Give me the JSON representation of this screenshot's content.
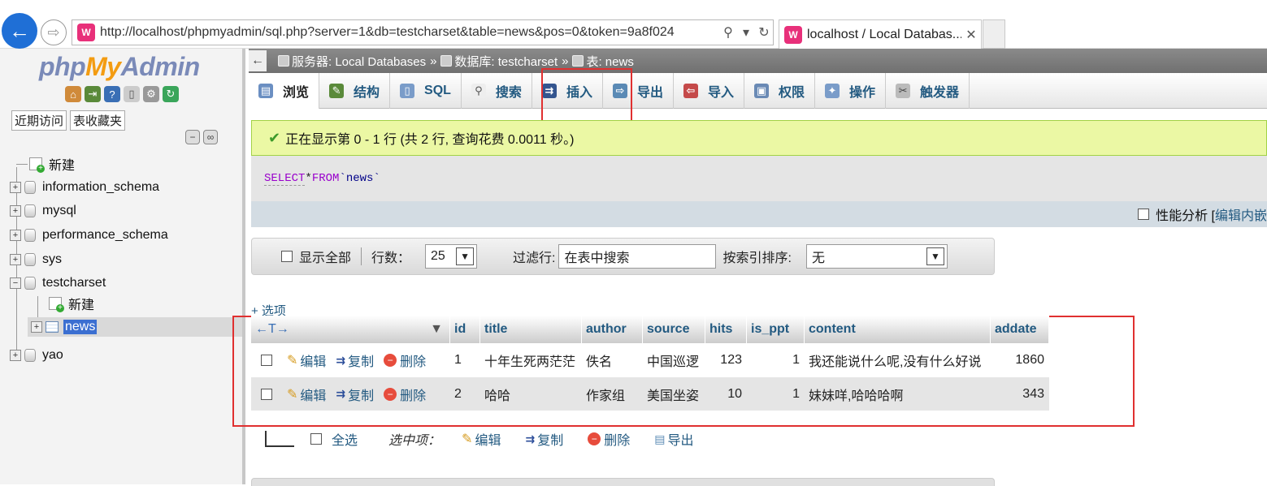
{
  "browser": {
    "url": "http://localhost/phpmyadmin/sql.php?server=1&db=testcharset&table=news&pos=0&token=9a8f024",
    "tab_title": "localhost / Local Databas...",
    "favicon": "W"
  },
  "left": {
    "logo": {
      "php": "php",
      "my": "My",
      "admin": "Admin"
    },
    "tabs": [
      "近期访问",
      "表收藏夹"
    ],
    "tree": {
      "new": "新建",
      "dbs": [
        "information_schema",
        "mysql",
        "performance_schema",
        "sys",
        "testcharset"
      ],
      "testcharset_new": "新建",
      "table": "news",
      "yao": "yao"
    }
  },
  "breadcrumb": {
    "server_label": "服务器: Local Databases",
    "db_label": "数据库: testcharset",
    "table_label": "表: news",
    "sep": "»"
  },
  "tabs": [
    "浏览",
    "结构",
    "SQL",
    "搜索",
    "插入",
    "导出",
    "导入",
    "权限",
    "操作",
    "触发器"
  ],
  "notice": "正在显示第 0 - 1 行 (共 2 行, 查询花费 0.0011 秒。)",
  "sql": {
    "select": "SELECT",
    "star": " * ",
    "from": "FROM",
    "table": " `news`"
  },
  "perf": {
    "label": "性能分析 [",
    "link": "编辑内嵌"
  },
  "nav": {
    "show_all": "显示全部",
    "rows_label": "行数：",
    "rows_value": "25",
    "filter_label": "过滤行:",
    "filter_placeholder": "在表中搜索",
    "sort_label": "按索引排序:",
    "sort_value": "无"
  },
  "options_link": "+ 选项",
  "table": {
    "arrows": "←T→",
    "columns": [
      "id",
      "title",
      "author",
      "source",
      "hits",
      "is_ppt",
      "content",
      "addate"
    ],
    "actions": {
      "edit": "编辑",
      "copy": "复制",
      "delete": "删除"
    },
    "rows": [
      {
        "id": "1",
        "title": "十年生死两茫茫",
        "author": "佚名",
        "source": "中国巡逻",
        "hits": "123",
        "is_ppt": "1",
        "content": "我还能说什么呢,没有什么好说",
        "addate": "1860"
      },
      {
        "id": "2",
        "title": "哈哈",
        "author": "作家组",
        "source": "美国坐姿",
        "hits": "10",
        "is_ppt": "1",
        "content": "妹妹咩,哈哈哈啊",
        "addate": "343"
      }
    ]
  },
  "bulk": {
    "select_all": "全选",
    "with_selected": "选中项：",
    "edit": "编辑",
    "copy": "复制",
    "delete": "删除",
    "export": "导出"
  }
}
